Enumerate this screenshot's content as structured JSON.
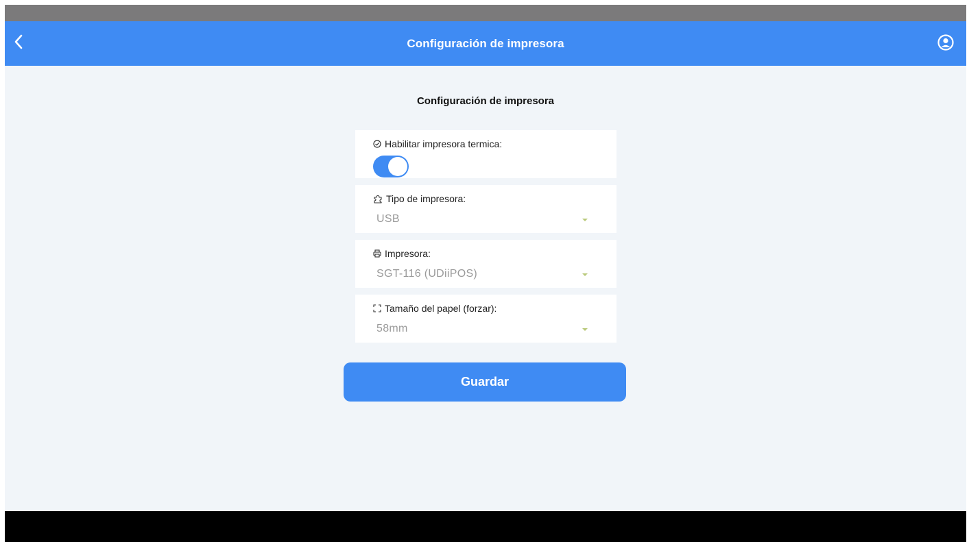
{
  "header": {
    "title": "Configuración de impresora",
    "back_icon": "chevron-left-icon",
    "profile_icon": "user-circle-icon"
  },
  "page": {
    "section_title": "Configuración de impresora"
  },
  "form": {
    "thermal_printer": {
      "label": "Habilitar impresora termica:",
      "icon": "check-circle-icon",
      "enabled": true
    },
    "printer_type": {
      "label": "Tipo de impresora:",
      "icon": "puzzle-icon",
      "value": "USB"
    },
    "printer": {
      "label": "Impresora:",
      "icon": "printer-icon",
      "value": "SGT-116 (UDiiPOS)"
    },
    "paper_size": {
      "label": "Tamaño del papel (forzar):",
      "icon": "expand-icon",
      "value": "58mm"
    }
  },
  "actions": {
    "save_label": "Guardar"
  },
  "colors": {
    "primary": "#3f8bf3",
    "background": "#f1f5f9",
    "caret": "#b9c97a"
  }
}
